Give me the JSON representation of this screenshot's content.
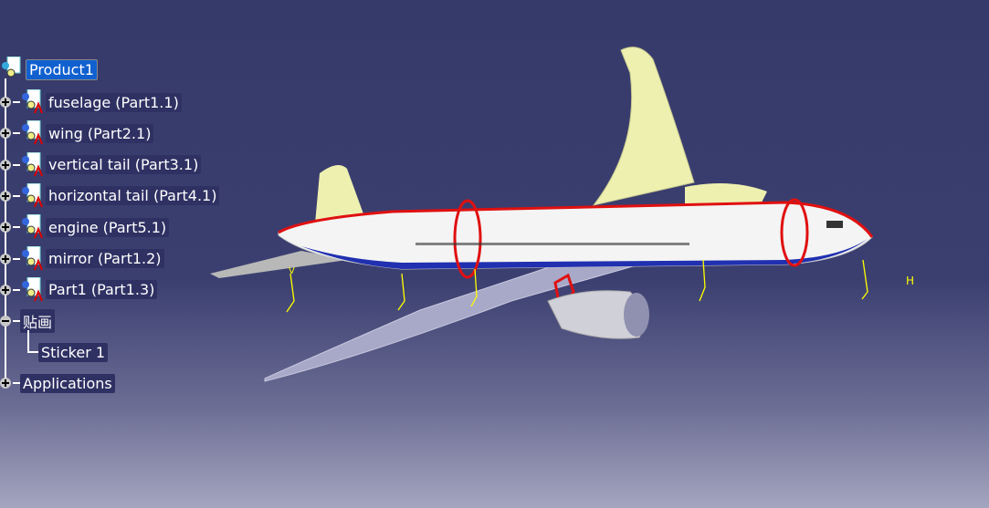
{
  "tree": {
    "root": {
      "label": "Product1",
      "selected": true,
      "icon": "product-icon"
    },
    "parts": [
      {
        "label": "fuselage (Part1.1)",
        "icon": "part-icon"
      },
      {
        "label": "wing (Part2.1)",
        "icon": "part-icon"
      },
      {
        "label": "vertical tail (Part3.1)",
        "icon": "part-icon"
      },
      {
        "label": "horizontal tail (Part4.1)",
        "icon": "part-icon"
      },
      {
        "label": "engine (Part5.1)",
        "icon": "part-icon"
      },
      {
        "label": "mirror (Part1.2)",
        "icon": "part-icon"
      },
      {
        "label": "Part1 (Part1.3)",
        "icon": "part-icon"
      }
    ],
    "stickers": {
      "label": "贴画",
      "children": [
        {
          "label": "Sticker 1"
        }
      ]
    },
    "applications": {
      "label": "Applications"
    }
  },
  "model": {
    "axis_labels": [
      "V",
      "H"
    ],
    "colors": {
      "body": "#f4f4f4",
      "tail": "#eef0b0",
      "section": "#e01010",
      "wing": "#a8a8c8"
    }
  }
}
